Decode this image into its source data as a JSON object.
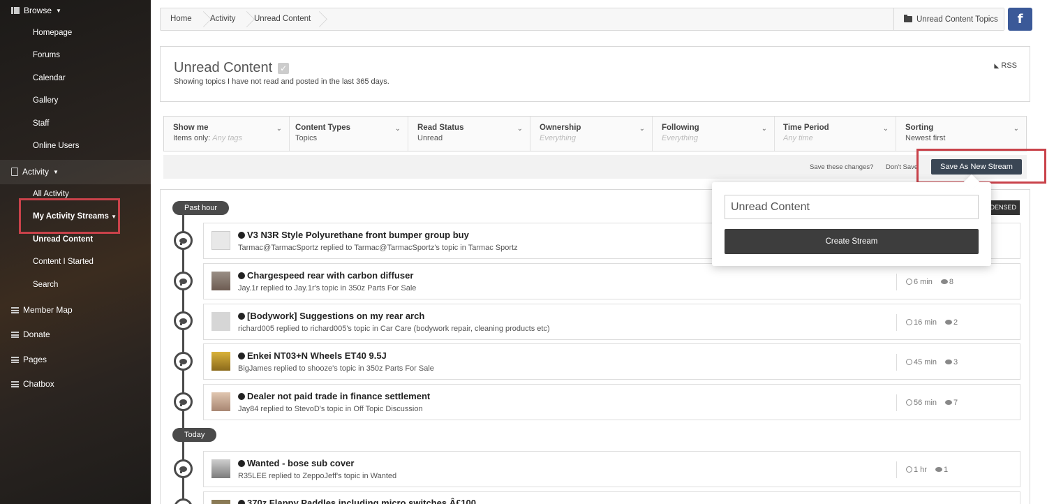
{
  "sidebar": {
    "browse": {
      "label": "Browse",
      "items": [
        "Homepage",
        "Forums",
        "Calendar",
        "Gallery",
        "Staff",
        "Online Users"
      ]
    },
    "activity": {
      "label": "Activity",
      "items": [
        "All Activity",
        "My Activity Streams",
        "Unread Content",
        "Content I Started",
        "Search"
      ]
    },
    "others": [
      "Member Map",
      "Donate",
      "Pages",
      "Chatbox"
    ]
  },
  "breadcrumb": {
    "items": [
      "Home",
      "Activity",
      "Unread Content"
    ],
    "topics_button": "Unread Content Topics",
    "facebook": "f"
  },
  "header": {
    "title": "Unread Content",
    "subtitle": "Showing topics I have not read and posted in the last 365 days.",
    "rss": "RSS"
  },
  "filters": [
    {
      "title": "Show me",
      "prefix": "Items only:",
      "value": "Any tags",
      "muted": true
    },
    {
      "title": "Content Types",
      "prefix": "",
      "value": "Topics",
      "muted": false
    },
    {
      "title": "Read Status",
      "prefix": "",
      "value": "Unread",
      "muted": false
    },
    {
      "title": "Ownership",
      "prefix": "",
      "value": "Everything",
      "muted": true
    },
    {
      "title": "Following",
      "prefix": "",
      "value": "Everything",
      "muted": true
    },
    {
      "title": "Time Period",
      "prefix": "",
      "value": "Any time",
      "muted": true
    },
    {
      "title": "Sorting",
      "prefix": "",
      "value": "Newest first",
      "muted": false
    }
  ],
  "save_bar": {
    "question": "Save these changes?",
    "dont_save": "Don't Save",
    "save_new": "Save As New Stream"
  },
  "popup": {
    "input_value": "Unread Content",
    "button": "Create Stream"
  },
  "condensed_label": "DENSED",
  "groups": [
    {
      "label": "Past hour"
    },
    {
      "label": "Today"
    }
  ],
  "rows": [
    {
      "title": "V3 N3R Style Polyurethane front bumper group buy",
      "meta": "Tarmac@TarmacSportz replied to Tarmac@TarmacSportz's topic in Tarmac Sportz",
      "time": "",
      "replies": ""
    },
    {
      "title": "Chargespeed rear with carbon diffuser",
      "meta": "Jay.1r replied to Jay.1r's topic in 350z Parts For Sale",
      "time": "6 min",
      "replies": "8"
    },
    {
      "title": "[Bodywork] Suggestions on my rear arch",
      "meta": "richard005 replied to richard005's topic in Car Care (bodywork repair, cleaning products etc)",
      "time": "16 min",
      "replies": "2"
    },
    {
      "title": "Enkei NT03+N Wheels ET40 9.5J",
      "meta": "BigJames replied to shooze's topic in 350z Parts For Sale",
      "time": "45 min",
      "replies": "3"
    },
    {
      "title": "Dealer not paid trade in finance settlement",
      "meta": "Jay84 replied to StevoD's topic in Off Topic Discussion",
      "time": "56 min",
      "replies": "7"
    },
    {
      "title": "Wanted - bose sub cover",
      "meta": "R35LEE replied to ZeppoJeff's topic in Wanted",
      "time": "1 hr",
      "replies": "1"
    },
    {
      "title": "370z Flappy Paddles including micro switches Â£100",
      "meta": "",
      "time": "",
      "replies": ""
    }
  ],
  "colors": {
    "accent_red": "#c9424a",
    "dark_button": "#3a4654",
    "facebook": "#3b5998"
  }
}
